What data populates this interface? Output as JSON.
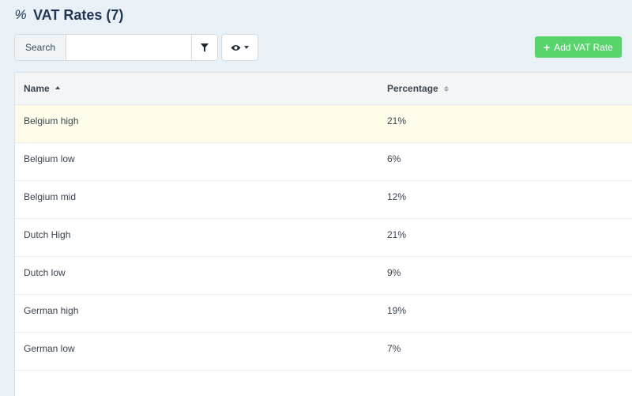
{
  "header": {
    "icon": "percent-icon",
    "icon_glyph": "%",
    "title": "VAT Rates (7)"
  },
  "toolbar": {
    "search_label": "Search",
    "search_value": "",
    "search_placeholder": "",
    "filter_icon": "filter-icon",
    "eye_icon": "eye-icon",
    "add_label": "Add VAT Rate",
    "add_icon_glyph": "+"
  },
  "table": {
    "columns": [
      {
        "label": "Name",
        "sort": "ascending"
      },
      {
        "label": "Percentage",
        "sort": "none"
      }
    ],
    "rows": [
      {
        "name": "Belgium high",
        "percentage": "21%"
      },
      {
        "name": "Belgium low",
        "percentage": "6%"
      },
      {
        "name": "Belgium mid",
        "percentage": "12%"
      },
      {
        "name": "Dutch High",
        "percentage": "21%"
      },
      {
        "name": "Dutch low",
        "percentage": "9%"
      },
      {
        "name": "German high",
        "percentage": "19%"
      },
      {
        "name": "German low",
        "percentage": "7%"
      }
    ],
    "highlighted_row": 0
  },
  "colors": {
    "accent": "#58d46d",
    "title": "#1e3554",
    "highlight": "#fffdea"
  }
}
